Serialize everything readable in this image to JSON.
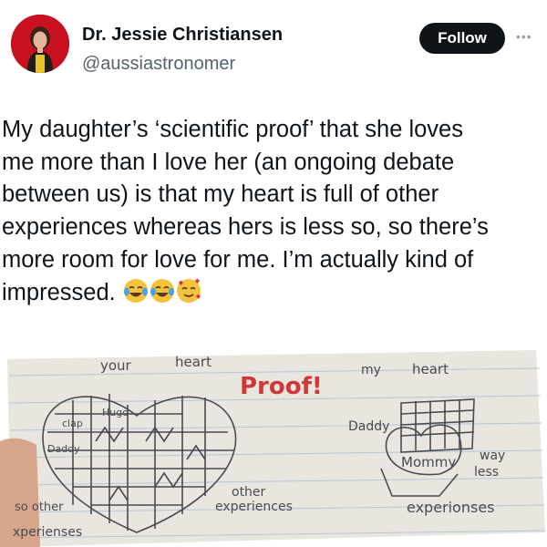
{
  "author": {
    "name": "Dr. Jessie Christiansen",
    "handle": "@aussiastronomer",
    "avatar_icon": "profile-photo"
  },
  "header": {
    "follow_label": "Follow",
    "more_icon": "more-icon"
  },
  "tweet": {
    "text": "My daughter’s ‘scientific proof’ that she loves\nme more than I love her (an ongoing debate\nbetween us) is that my heart is full of other\nexperiences whereas hers is less so, so there’s\nmore room for love for me. I’m actually kind of\nimpressed.",
    "emojis": [
      "face-with-tears-of-joy-emoji",
      "face-with-tears-of-joy-emoji",
      "smiling-face-with-hearts-emoji"
    ]
  },
  "photo": {
    "labels": {
      "your": "your",
      "heart_left": "heart",
      "proof": "Proof!",
      "my": "my",
      "heart_right": "heart",
      "daddy_right": "Daddy",
      "mommy": "Mommy",
      "way_less": "way\nless",
      "experiences_right": "experionses",
      "other_middle": "other\nexperiences",
      "so_other": "so other",
      "experiences_left": "xperienses",
      "clap": "clap",
      "hugo": "Hugo",
      "daddy_left": "Daddy"
    },
    "colors": {
      "paper": "#e9e5df",
      "rule_line": "#b9c4d8",
      "pencil": "#4a4a52",
      "proof_red": "#cf3838"
    }
  }
}
